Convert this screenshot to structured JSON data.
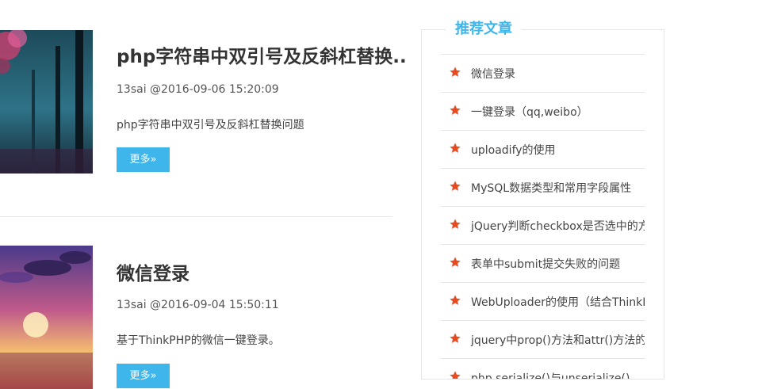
{
  "articles": [
    {
      "title": "php字符串中双引号及反斜杠替换..",
      "meta": "13sai @2016-09-06 15:20:09",
      "excerpt": "php字符串中双引号及反斜杠替换问题",
      "more_label": "更多»",
      "thumb_colors": [
        "#0f2530",
        "#2a6a7c",
        "#c03a6a"
      ]
    },
    {
      "title": "微信登录",
      "meta": "13sai @2016-09-04 15:50:11",
      "excerpt": "基于ThinkPHP的微信一键登录。",
      "more_label": "更多»",
      "thumb_colors": [
        "#3a2a6a",
        "#e05a6a",
        "#f8d070"
      ]
    }
  ],
  "sidebar": {
    "heading": "推荐文章",
    "items": [
      "微信登录",
      "一键登录（qq,weibo）",
      "uploadify的使用",
      "MySQL数据类型和常用字段属性",
      "jQuery判断checkbox是否选中的方法",
      "表单中submit提交失败的问题",
      "WebUploader的使用（结合ThinkPHP）",
      "jquery中prop()方法和attr()方法的区别",
      "php serialize()与unserialize()"
    ]
  },
  "colors": {
    "accent": "#3eb6ec",
    "star": "#ea4a1f"
  }
}
